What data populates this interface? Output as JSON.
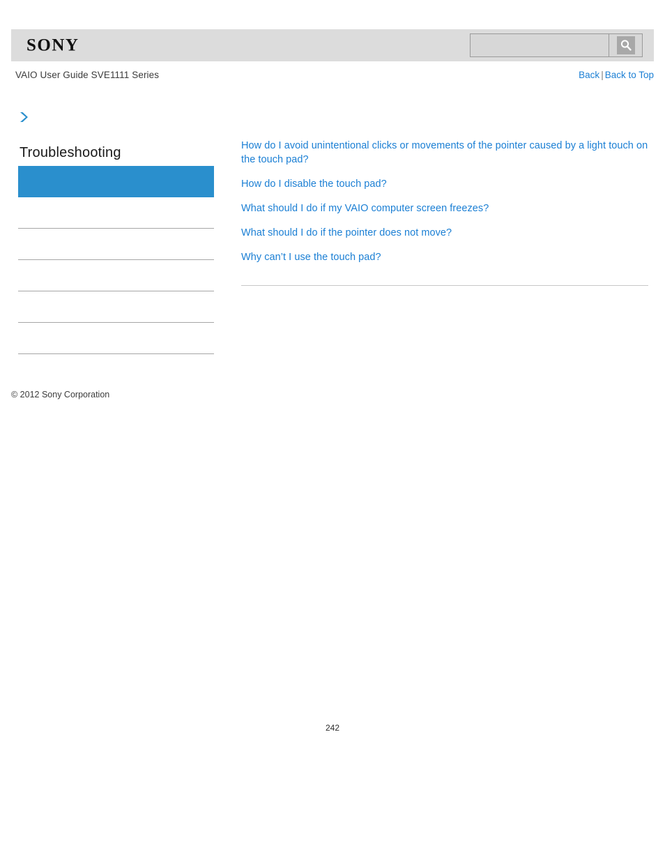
{
  "header": {
    "logo_text": "SONY",
    "logo_icon": "sony-logo",
    "search": {
      "value": "",
      "placeholder": "",
      "icon": "search-magnifier-icon"
    }
  },
  "sub_header": {
    "guide_title": "VAIO User Guide SVE1111 Series",
    "back_label": "Back",
    "separator": "|",
    "back_to_top_label": "Back to Top"
  },
  "sidebar": {
    "chevron_icon": "chevron-right-icon",
    "heading": "Troubleshooting",
    "accent_color": "#2a8fcd",
    "items": [
      {
        "label": "",
        "selected": true
      },
      {
        "label": "",
        "selected": false
      },
      {
        "label": "",
        "selected": false
      },
      {
        "label": "",
        "selected": false
      },
      {
        "label": "",
        "selected": false
      },
      {
        "label": "",
        "selected": false
      }
    ]
  },
  "main": {
    "link_color": "#1b7fd4",
    "links": [
      "How do I avoid unintentional clicks or movements of the pointer caused by a light touch on the touch pad?",
      "How do I disable the touch pad?",
      "What should I do if my VAIO computer screen freezes?",
      "What should I do if the pointer does not move?",
      "Why can’t I use the touch pad?"
    ]
  },
  "footer": {
    "copyright": "© 2012 Sony Corporation",
    "page_number": "242"
  }
}
